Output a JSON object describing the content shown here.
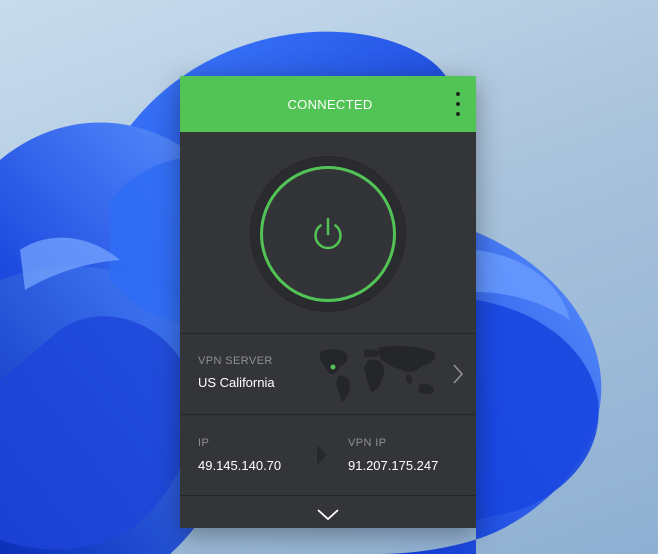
{
  "status": {
    "title": "CONNECTED"
  },
  "colors": {
    "accent": "#52c456",
    "panel_bg": "#343539",
    "label": "#8e9095",
    "text": "#ffffff"
  },
  "icons": {
    "menu": "vertical-dots-icon",
    "power": "power-icon",
    "map": "world-map-icon",
    "next": "chevron-right-icon",
    "arrow": "arrow-right-icon",
    "expand": "chevron-down-icon"
  },
  "server": {
    "label": "VPN SERVER",
    "value": "US California"
  },
  "ip": {
    "ip_label": "IP",
    "ip_value": "49.145.140.70",
    "vpn_ip_label": "VPN IP",
    "vpn_ip_value": "91.207.175.247"
  }
}
